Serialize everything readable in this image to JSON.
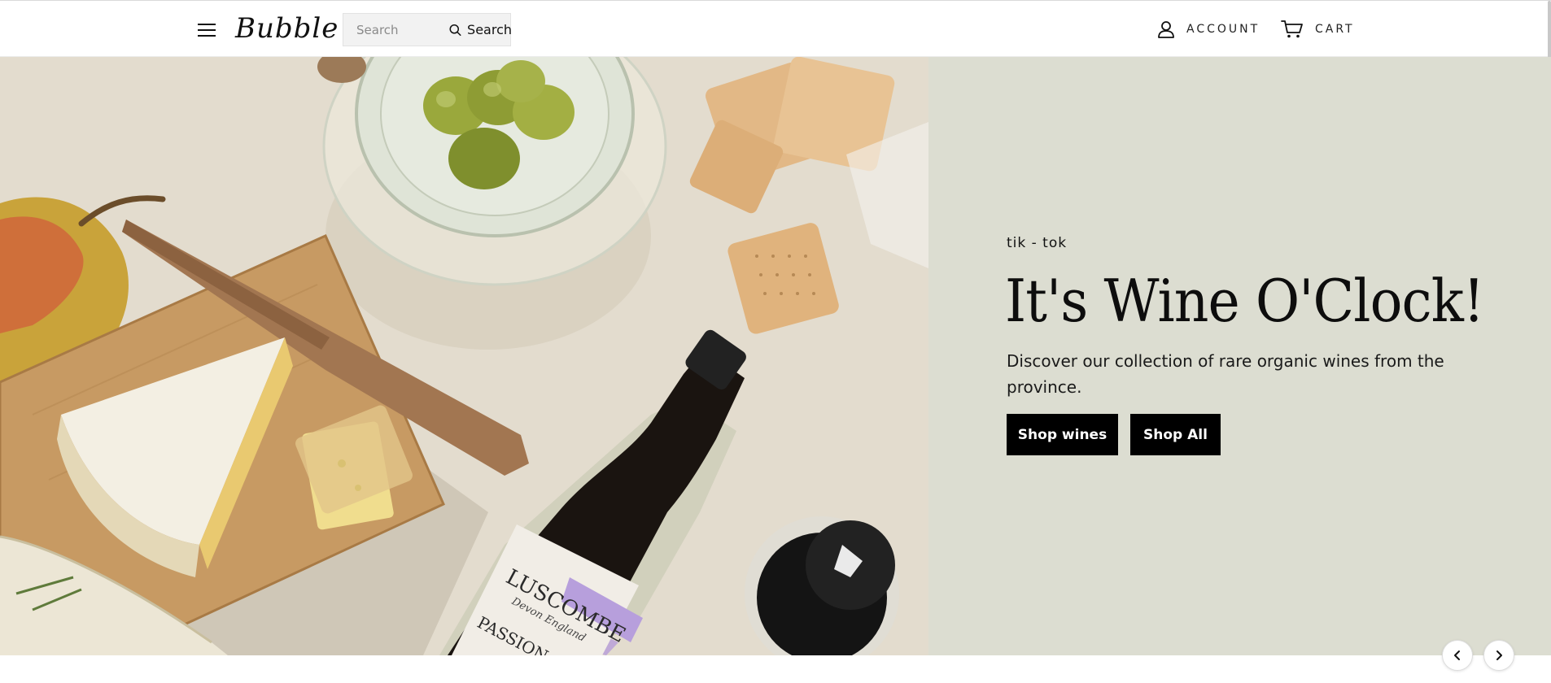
{
  "header": {
    "logo_text": "Bubble",
    "search": {
      "placeholder": "Search",
      "value": "",
      "button_label": "Search"
    },
    "account_label": "ACCOUNT",
    "cart_label": "CART",
    "icons": {
      "menu": "hamburger-menu-icon",
      "search": "search-icon",
      "account": "user-icon",
      "cart": "cart-icon"
    }
  },
  "hero": {
    "eyebrow": "tik - tok",
    "title": "It's Wine O'Clock!",
    "subtitle": "Discover our collection of rare organic wines from the province.",
    "buttons": {
      "primary": "Shop wines",
      "secondary": "Shop All"
    },
    "panel_color": "#dcddd1",
    "image": {
      "bottle_label_brand": "LUSCOMBE",
      "bottle_label_sub": "Devon England",
      "bottle_label_lower": "PASSION"
    }
  },
  "slider": {
    "prev_icon": "chevron-left-icon",
    "next_icon": "chevron-right-icon"
  },
  "colors": {
    "accent": "#000000",
    "panel": "#dcddd1",
    "button_text": "#ffffff"
  }
}
